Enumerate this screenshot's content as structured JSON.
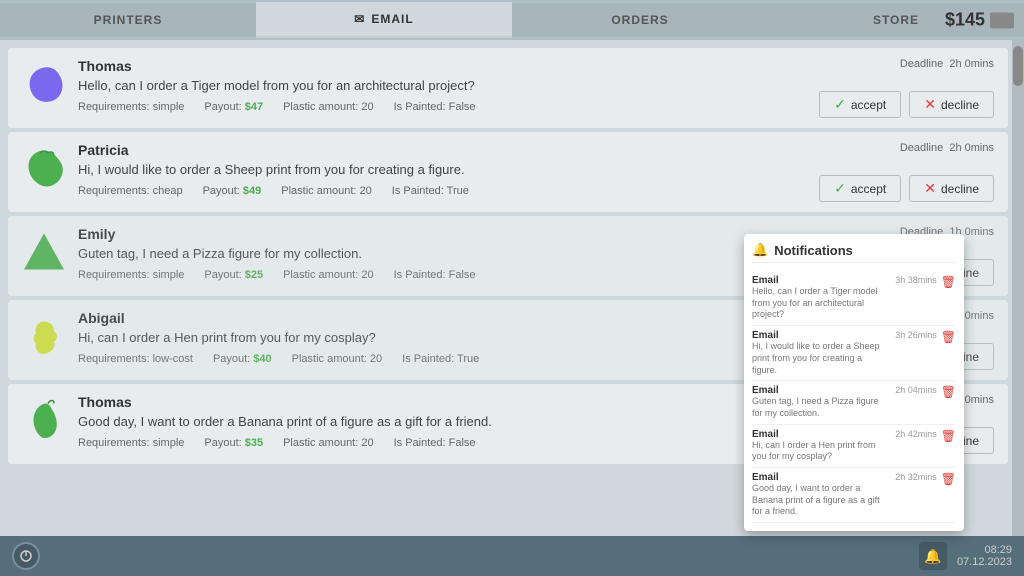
{
  "nav": {
    "tabs": [
      {
        "id": "printers",
        "label": "PRINTERS",
        "active": false
      },
      {
        "id": "email",
        "label": "EMAIL",
        "active": true
      },
      {
        "id": "orders",
        "label": "ORDERS",
        "active": false
      },
      {
        "id": "store",
        "label": "STORE",
        "active": false
      }
    ],
    "balance": "$145"
  },
  "emails": [
    {
      "id": 1,
      "sender": "Thomas",
      "message": "Hello, can I order a Tiger model from you for an architectural project?",
      "deadline": "Deadline",
      "deadline_time": "2h 0mins",
      "requirements": "Requirements: simple",
      "payout_label": "Payout:",
      "payout": "$47",
      "plastic_label": "Plastic amount:",
      "plastic": "20",
      "painted_label": "Is Painted:",
      "painted": "False",
      "avatar_color": "#7b68ee",
      "shape": "blob1"
    },
    {
      "id": 2,
      "sender": "Patricia",
      "message": "Hi, I would like to order a Sheep print from you for creating a figure.",
      "deadline": "Deadline",
      "deadline_time": "2h 0mins",
      "requirements": "Requirements: cheap",
      "payout_label": "Payout:",
      "payout": "$49",
      "plastic_label": "Plastic amount:",
      "plastic": "20",
      "painted_label": "Is Painted:",
      "painted": "True",
      "avatar_color": "#4caf50",
      "shape": "blob2"
    },
    {
      "id": 3,
      "sender": "Emily",
      "message": "Guten tag, I need a Pizza figure for my collection.",
      "deadline": "Deadline",
      "deadline_time": "1h 0mins",
      "requirements": "Requirements: simple",
      "payout_label": "Payout:",
      "payout": "$25",
      "plastic_label": "Plastic amount:",
      "plastic": "20",
      "painted_label": "Is Painted:",
      "painted": "False",
      "avatar_color": "#4caf50",
      "shape": "blob3"
    },
    {
      "id": 4,
      "sender": "Abigail",
      "message": "Hi, can I order a Hen print from you for my cosplay?",
      "deadline": "Deadline",
      "deadline_time": "2h 0mins",
      "requirements": "Requirements: low-cost",
      "payout_label": "Payout:",
      "payout": "$40",
      "plastic_label": "Plastic amount:",
      "plastic": "20",
      "painted_label": "Is Painted:",
      "painted": "True",
      "avatar_color": "#cddc39",
      "shape": "blob4"
    },
    {
      "id": 5,
      "sender": "Thomas",
      "message": "Good day, I want to order a Banana print of a figure as a gift for a friend.",
      "deadline": "Deadline",
      "deadline_time": "2h 0mins",
      "requirements": "Requirements: simple",
      "payout_label": "Payout:",
      "payout": "$35",
      "plastic_label": "Plastic amount:",
      "plastic": "20",
      "painted_label": "Is Painted:",
      "painted": "False",
      "avatar_color": "#4caf50",
      "shape": "blob5"
    }
  ],
  "buttons": {
    "accept": "accept",
    "decline": "decline"
  },
  "notifications": {
    "title": "Notifications",
    "items": [
      {
        "type": "Email",
        "text": "Hello, can I order a Tiger model from you for an architectural project?",
        "time": "3h 38mins"
      },
      {
        "type": "Email",
        "text": "Hi, I would like to order a Sheep print from you for creating a figure.",
        "time": "3h 26mins"
      },
      {
        "type": "Email",
        "text": "Guten tag, I need a Pizza figure for my collection.",
        "time": "2h 04mins"
      },
      {
        "type": "Email",
        "text": "Hi, can I order a Hen print from you for my cosplay?",
        "time": "2h 42mins"
      },
      {
        "type": "Email",
        "text": "Good day, I want to order a Banana print of a figure as a gift for a friend.",
        "time": "2h 32mins"
      }
    ]
  },
  "bottom_bar": {
    "time": "08:29",
    "date": "07.12.2023"
  }
}
